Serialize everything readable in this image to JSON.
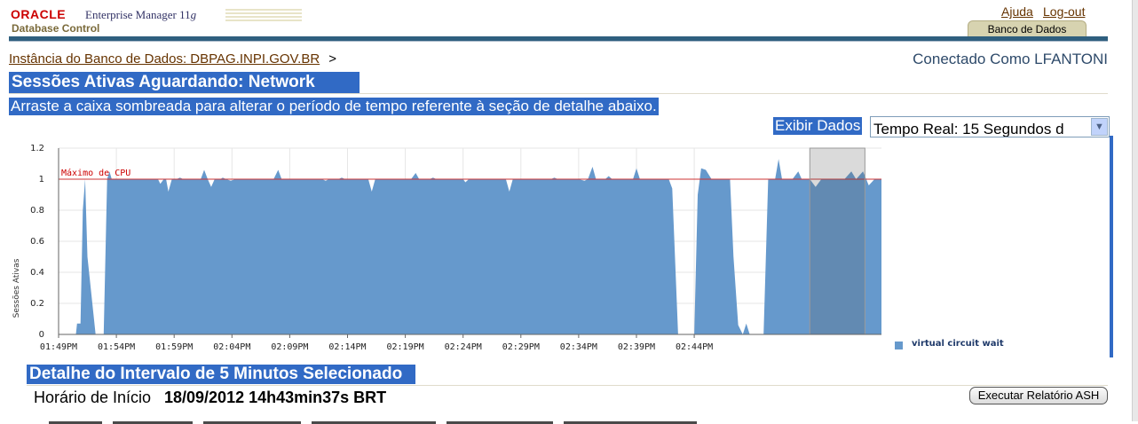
{
  "header": {
    "brand": "ORACLE",
    "product": "Enterprise Manager 11",
    "product_suffix": "g",
    "subtitle": "Database Control",
    "help_link": "Ajuda",
    "logout_link": "Log-out",
    "active_tab": "Banco de Dados"
  },
  "breadcrumb": {
    "link": "Instância do Banco de Dados: DBPAG.INPI.GOV.BR",
    "separator": ">"
  },
  "connected_as": "Conectado Como LFANTONI",
  "page_title": "Sessões Ativas Aguardando: Network",
  "instruction": "Arraste a caixa sombreada para alterar o período de tempo referente à seção de detalhe abaixo.",
  "view_data": {
    "label": "Exibir Dados",
    "selected": "Tempo Real: 15 Segundos d"
  },
  "colors": {
    "area": "#6699cc",
    "cpu_line": "#cc3333",
    "selection": "#316ac5"
  },
  "chart_data": {
    "type": "area",
    "ylabel": "Sessões Ativas",
    "ylim": [
      0,
      1.2
    ],
    "yticks": [
      "1.2",
      "1",
      "0.8",
      "0.6",
      "0.4",
      "0.2",
      "0"
    ],
    "xticks": [
      "01:49PM",
      "01:54PM",
      "01:59PM",
      "02:04PM",
      "02:09PM",
      "02:14PM",
      "02:19PM",
      "02:24PM",
      "02:29PM",
      "02:34PM",
      "02:39PM",
      "02:44PM"
    ],
    "x_start_min": 0,
    "x_tick_step_min": 5,
    "cpu_max_label": "Máximo de CPU",
    "cpu_max_value": 1,
    "series": [
      {
        "name": "virtual circuit wait",
        "points": [
          [
            1.5,
            0
          ],
          [
            1.6,
            0.07
          ],
          [
            1.9,
            0.07
          ],
          [
            2.1,
            0.8
          ],
          [
            2.3,
            1.0
          ],
          [
            2.5,
            0.5
          ],
          [
            3.2,
            0
          ],
          [
            3.9,
            0
          ],
          [
            4.2,
            1.0
          ],
          [
            4.4,
            1.05
          ],
          [
            4.6,
            1.0
          ],
          [
            8.6,
            1.0
          ],
          [
            8.8,
            0.97
          ],
          [
            9.1,
            1.0
          ],
          [
            9.3,
            1.0
          ],
          [
            9.5,
            0.92
          ],
          [
            9.8,
            1.0
          ],
          [
            10.2,
            1.0
          ],
          [
            10.5,
            1.01
          ],
          [
            10.8,
            1.0
          ],
          [
            12.3,
            1.0
          ],
          [
            12.6,
            1.06
          ],
          [
            12.9,
            1.0
          ],
          [
            13.2,
            0.95
          ],
          [
            13.5,
            1.0
          ],
          [
            14.0,
            1.0
          ],
          [
            14.2,
            1.01
          ],
          [
            14.5,
            1.0
          ],
          [
            14.9,
            0.99
          ],
          [
            15.3,
            1.0
          ],
          [
            18.6,
            1.0
          ],
          [
            19.0,
            1.06
          ],
          [
            19.3,
            1.0
          ],
          [
            22.8,
            1.0
          ],
          [
            23.1,
            0.99
          ],
          [
            23.4,
            1.0
          ],
          [
            24.2,
            1.0
          ],
          [
            24.5,
            1.01
          ],
          [
            24.8,
            1.0
          ],
          [
            26.8,
            1.0
          ],
          [
            27.1,
            0.92
          ],
          [
            27.4,
            1.0
          ],
          [
            30.5,
            1.0
          ],
          [
            30.9,
            1.04
          ],
          [
            31.2,
            1.0
          ],
          [
            32.1,
            1.0
          ],
          [
            32.4,
            1.01
          ],
          [
            32.7,
            1.0
          ],
          [
            35.0,
            1.0
          ],
          [
            35.2,
            0.98
          ],
          [
            35.5,
            1.0
          ],
          [
            38.7,
            1.0
          ],
          [
            39.0,
            0.92
          ],
          [
            39.3,
            1.0
          ],
          [
            42.6,
            1.0
          ],
          [
            42.9,
            1.01
          ],
          [
            43.2,
            1.0
          ],
          [
            44.7,
            1.0
          ],
          [
            45.0,
            1.0
          ],
          [
            45.5,
            0.99
          ],
          [
            45.8,
            1.0
          ],
          [
            46.2,
            1.08
          ],
          [
            46.5,
            1.0
          ],
          [
            47.3,
            1.0
          ],
          [
            47.6,
            1.02
          ],
          [
            47.9,
            1.0
          ],
          [
            49.7,
            1.0
          ],
          [
            50.0,
            1.07
          ],
          [
            50.3,
            1.0
          ],
          [
            52.8,
            1.0
          ],
          [
            53.1,
            0.94
          ],
          [
            53.6,
            0
          ],
          [
            55.0,
            0
          ],
          [
            55.3,
            0.9
          ],
          [
            55.6,
            1.07
          ],
          [
            56.0,
            1.06
          ],
          [
            56.5,
            1.0
          ],
          [
            58.1,
            1.0
          ],
          [
            58.4,
            0.5
          ],
          [
            58.8,
            0.06
          ],
          [
            59.2,
            0
          ],
          [
            59.5,
            0.07
          ],
          [
            59.8,
            0
          ],
          [
            60.1,
            0
          ],
          [
            60.4,
            0
          ],
          [
            61.0,
            0
          ],
          [
            61.4,
            1.0
          ],
          [
            62.0,
            1.0
          ],
          [
            62.3,
            1.13
          ],
          [
            62.6,
            1.0
          ],
          [
            63.0,
            1.0
          ],
          [
            63.5,
            1.0
          ],
          [
            64.0,
            1.05
          ],
          [
            64.3,
            1.0
          ],
          [
            65.0,
            1.0
          ],
          [
            65.5,
            0.95
          ],
          [
            66.0,
            1.0
          ],
          [
            68.0,
            1.0
          ],
          [
            68.6,
            1.05
          ],
          [
            69.0,
            1.0
          ],
          [
            69.6,
            1.05
          ],
          [
            70.1,
            0.96
          ],
          [
            70.6,
            1.0
          ],
          [
            71.2,
            1.0
          ]
        ]
      }
    ],
    "selection_window_min": [
      65.0,
      70.0
    ]
  },
  "detail": {
    "title": "Detalhe do Intervalo de 5 Minutos Selecionado",
    "start_label": "Horário de Início",
    "start_value": "18/09/2012 14h43min37s BRT",
    "run_ash_button": "Executar Relatório ASH"
  }
}
